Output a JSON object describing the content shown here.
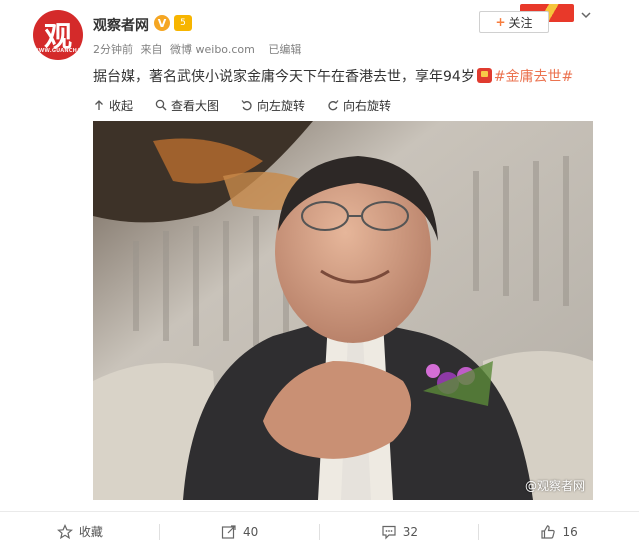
{
  "header": {
    "avatar_text": "观",
    "avatar_subtext": "WWW.GUANCHA.CN",
    "nickname": "观察者网",
    "verified_badge": "V",
    "level_badge": "5",
    "meta_time": "2分钟前",
    "meta_from": "来自",
    "meta_source": "微博 weibo.com",
    "meta_edited": "已编辑",
    "follow_label": "关注",
    "follow_plus": "+"
  },
  "post": {
    "text_main": "据台媒，著名武侠小说家金庸今天下午在香港去世，享年94岁",
    "hashtag": "#金庸去世#"
  },
  "image_toolbar": {
    "collapse": "收起",
    "view_large": "查看大图",
    "rotate_left": "向左旋转",
    "rotate_right": "向右旋转"
  },
  "photo": {
    "watermark": "@观察者网"
  },
  "actions": {
    "favorite_label": "收藏",
    "repost_count": "40",
    "comment_count": "32",
    "like_count": "16"
  },
  "colors": {
    "accent": "#eb7350",
    "brand_red": "#d42a2a",
    "verified": "#f5a623"
  },
  "icons": [
    "collapse-icon",
    "zoom-icon",
    "rotate-left-icon",
    "rotate-right-icon",
    "star-icon",
    "repost-icon",
    "comment-icon",
    "like-icon",
    "chevron-down-icon"
  ]
}
